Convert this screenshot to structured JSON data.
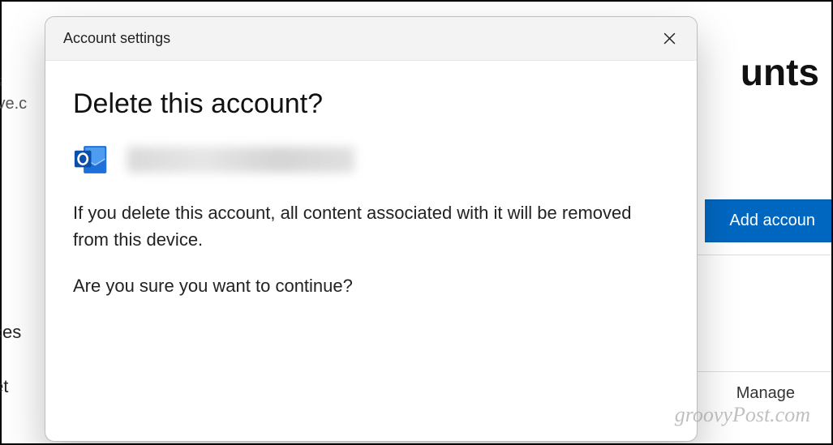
{
  "background": {
    "heading_fragment": "unts",
    "sidebar": {
      "item1": "s",
      "item2": "ive.c",
      "item3": "ces",
      "item4": "et"
    },
    "add_button": "Add accoun",
    "manage": "Manage"
  },
  "dialog": {
    "title": "Account settings",
    "heading": "Delete this account?",
    "warning_line": "If you delete this account, all content associated with it will be removed from this device.",
    "confirm_line": "Are you sure you want to continue?"
  },
  "watermark": "groovyPost.com"
}
